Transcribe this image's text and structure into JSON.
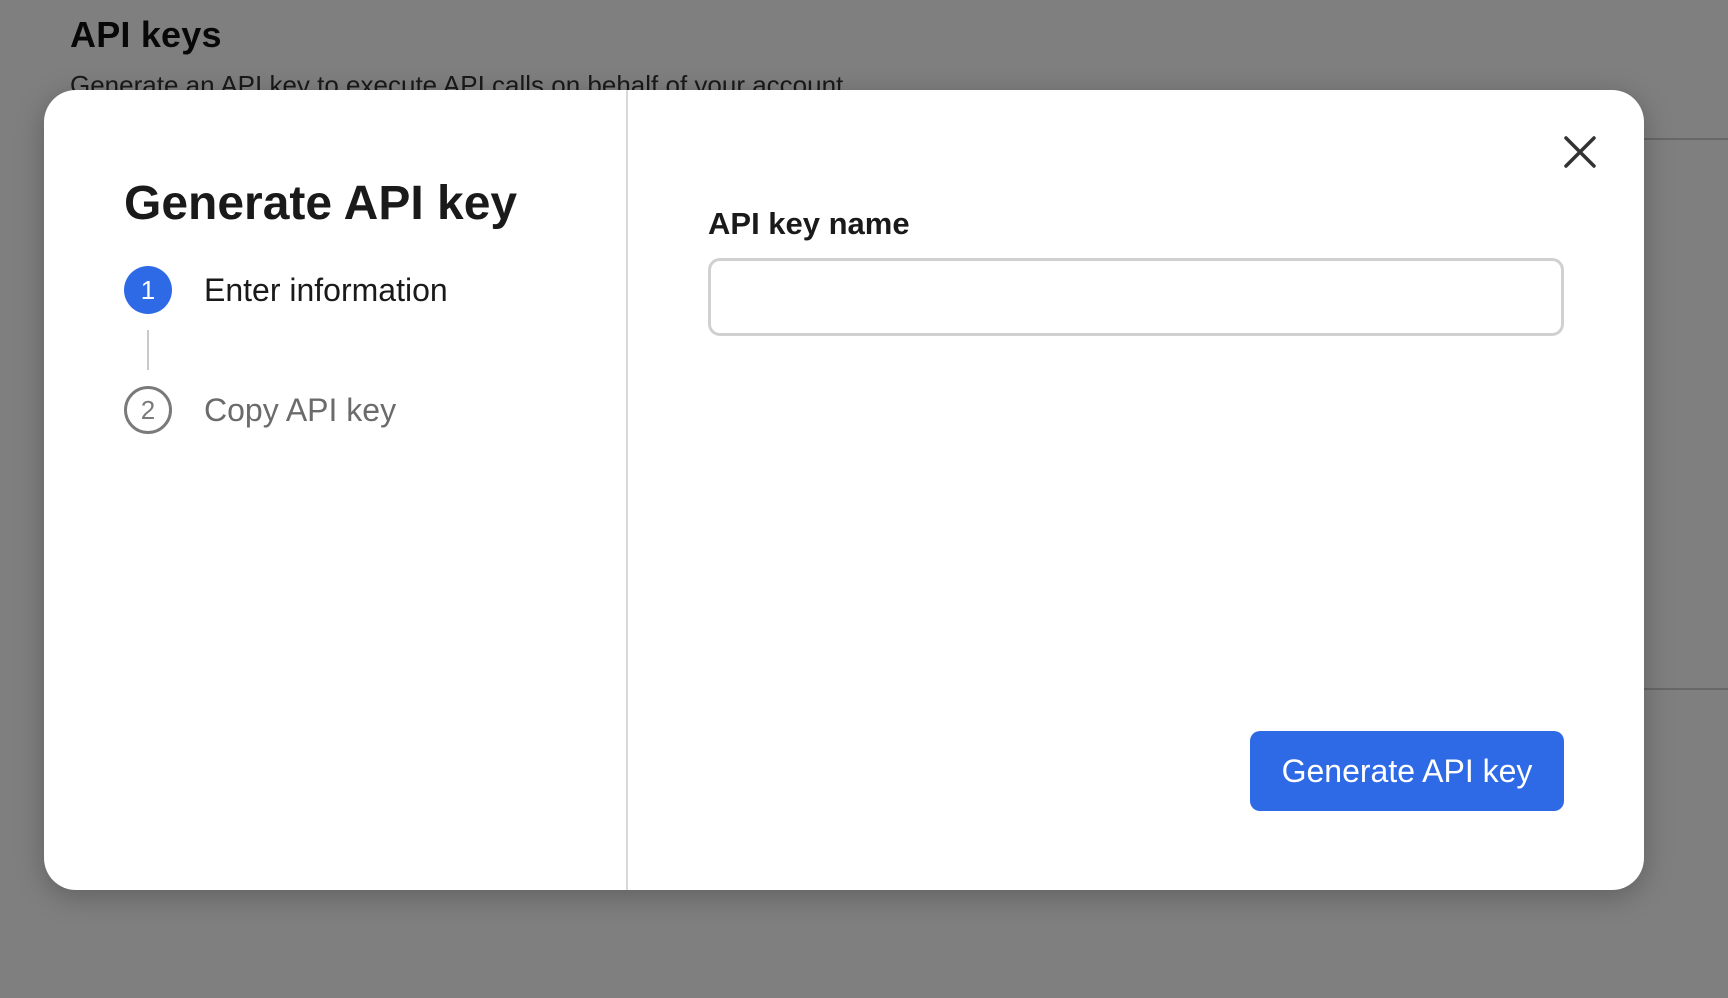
{
  "page": {
    "title": "API keys",
    "subtitle": "Generate an API key to execute API calls on behalf of your account"
  },
  "modal": {
    "title": "Generate API key",
    "steps": [
      {
        "number": "1",
        "label": "Enter information",
        "state": "active"
      },
      {
        "number": "2",
        "label": "Copy API key",
        "state": "inactive"
      }
    ],
    "close_icon": "close-icon",
    "field": {
      "label": "API key name",
      "value": "",
      "placeholder": ""
    },
    "submit_label": "Generate API key"
  },
  "colors": {
    "accent": "#2f6ae6",
    "overlay": "rgba(0,0,0,0.5)"
  }
}
